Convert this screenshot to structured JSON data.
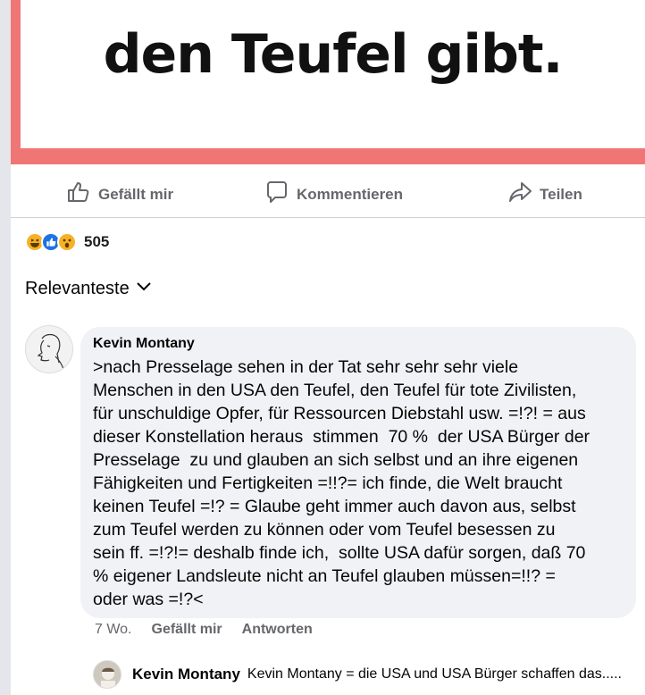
{
  "post": {
    "image_text_line1": "",
    "image_text_line2": "den Teufel gibt."
  },
  "actions": {
    "like": "Gefällt mir",
    "comment": "Kommentieren",
    "share": "Teilen"
  },
  "reactions": {
    "icons": [
      "haha-icon",
      "like-icon",
      "wow-icon"
    ],
    "count": "505"
  },
  "sort": {
    "label": "Relevanteste"
  },
  "comment": {
    "author": "Kevin Montany",
    "text": ">nach Presselage sehen in der Tat sehr sehr sehr viele\nMenschen in den USA den Teufel, den Teufel für tote Zivilisten,\nfür unschuldige Opfer, für Ressourcen Diebstahl usw. =!?! = aus\ndieser Konstellation heraus  stimmen  70 %  der USA Bürger der\nPresselage  zu und glauben an sich selbst und an ihre eigenen\nFähigkeiten und Fertigkeiten =!!?= ich finde, die Welt braucht\nkeinen Teufel =!? = Glaube geht immer auch davon aus, selbst\nzum Teufel werden zu können oder vom Teufel besessen zu\nsein ff. =!?!= deshalb finde ich,  sollte USA dafür sorgen, daß 70\n% eigener Landsleute nicht an Teufel glauben müssen=!!? =\noder was =!?<",
    "time": "7 Wo.",
    "like": "Gefällt mir",
    "reply": "Antworten"
  },
  "reply": {
    "author": "Kevin Montany",
    "text": "Kevin Montany = die USA und USA Bürger schaffen das....."
  },
  "colors": {
    "frame": "#f07676",
    "bubble": "#f0f2f5",
    "muted": "#65676b",
    "like_blue": "#1b74e4",
    "emoji_yellow": "#f7b125"
  }
}
